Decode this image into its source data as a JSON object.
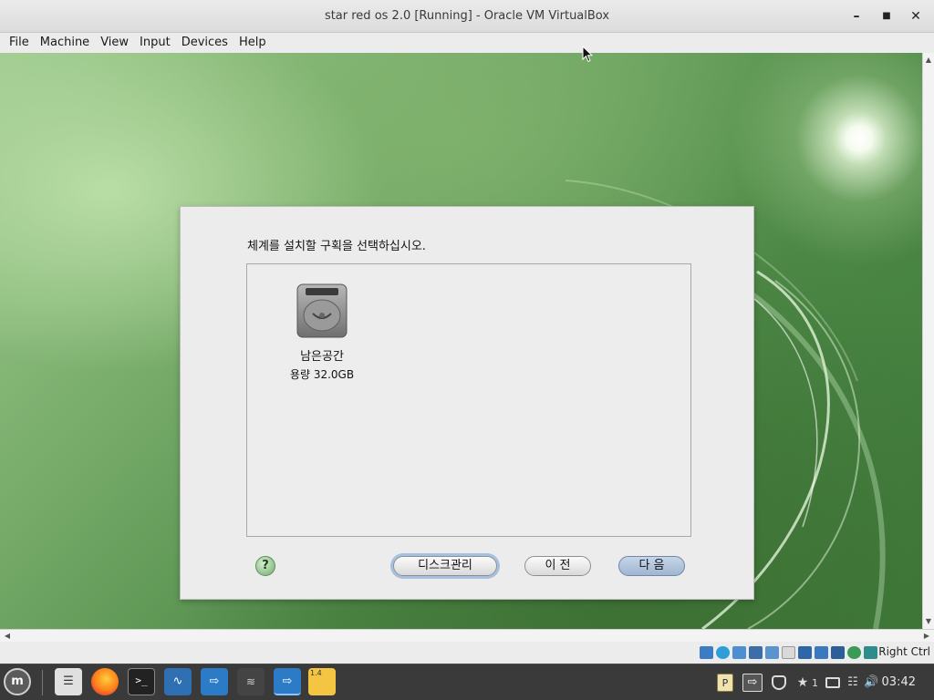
{
  "window": {
    "title": "star red os 2.0 [Running] - Oracle VM VirtualBox",
    "minimize_icon": "minimize-icon",
    "maximize_icon": "maximize-icon",
    "close_icon": "close-icon"
  },
  "menu": [
    "File",
    "Machine",
    "View",
    "Input",
    "Devices",
    "Help"
  ],
  "installer": {
    "prompt": "체계를 설치할 구획을 선택하십시오.",
    "disk": {
      "name": "남은공간",
      "size": "용량 32.0GB",
      "icon": "hard-disk-icon"
    },
    "buttons": {
      "help": "?",
      "disk_manager": "디스크관리",
      "back": "이 전",
      "next": "다 음"
    }
  },
  "vbox_status": {
    "host_key": "Right Ctrl",
    "icons": [
      "hard-disk-icon",
      "optical-drive-icon",
      "audio-icon",
      "network-icon",
      "usb-icon",
      "shared-folders-icon",
      "display-icon",
      "video-capture-icon",
      "mouse-integration-icon",
      "keyboard-icon",
      "arrow-icon"
    ]
  },
  "taskbar": {
    "apps": [
      "mint-menu-icon",
      "file-manager-icon",
      "firefox-icon",
      "terminal-icon",
      "system-monitor-icon",
      "virtualbox-icon",
      "wireshark-icon",
      "virtualbox-icon",
      "notes-icon"
    ],
    "notes_badge": "1.4",
    "tray": {
      "updates_count": "1",
      "time": "03:42"
    }
  }
}
